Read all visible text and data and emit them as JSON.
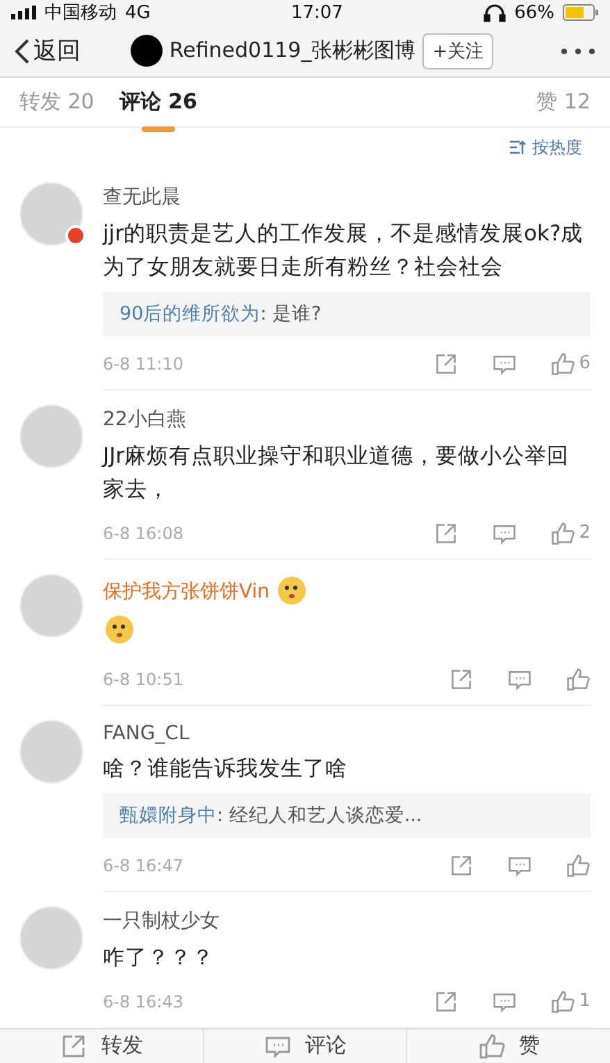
{
  "status_bar": {
    "carrier": "中国移动",
    "network": "4G",
    "time": "17:07",
    "battery": "66%"
  },
  "nav": {
    "back": "返回",
    "title": "Refined0119_张彬彬图博",
    "follow": "+关注"
  },
  "tabs": [
    {
      "label": "转发 20",
      "selected": false
    },
    {
      "label": "评论 26",
      "selected": true
    },
    {
      "label": "赞 12",
      "selected": false
    }
  ],
  "sort": "按热度",
  "comments": [
    {
      "name": "查无此晨",
      "vip": false,
      "kind": "text",
      "body": "jjr的职责是艺人的工作发展，不是感情发展ok?成为了女朋友就要日走所有粉丝？社会社会",
      "reply": {
        "user": "90后的维所欲为",
        "text": ": 是谁?"
      },
      "time": "6-8 11:10",
      "likes": "6",
      "badge": true
    },
    {
      "name": "22小白燕",
      "vip": false,
      "kind": "text",
      "body": "JJr麻烦有点职业操守和职业道德，要做小公举回家去，",
      "time": "6-8 16:08",
      "likes": "2",
      "badge": false
    },
    {
      "name": "保护我方张饼饼Vin",
      "vip": true,
      "kind": "sticker",
      "time": "6-8 10:51",
      "badge": false
    },
    {
      "name": "FANG_CL",
      "vip": false,
      "kind": "text",
      "body": "啥？谁能告诉我发生了啥",
      "reply": {
        "user": "甄嬛附身中",
        "text": ": 经纪人和艺人谈恋爱..."
      },
      "time": "6-8 16:47",
      "badge": false
    },
    {
      "name": "一只制杖少女",
      "vip": false,
      "kind": "text",
      "body": "咋了？？？",
      "time": "6-8 16:43",
      "likes": "1",
      "badge": false
    }
  ],
  "bottom_bar": [
    {
      "kind": "repost",
      "label": "转发"
    },
    {
      "kind": "comment",
      "label": "评论"
    },
    {
      "kind": "like",
      "label": "赞"
    }
  ]
}
